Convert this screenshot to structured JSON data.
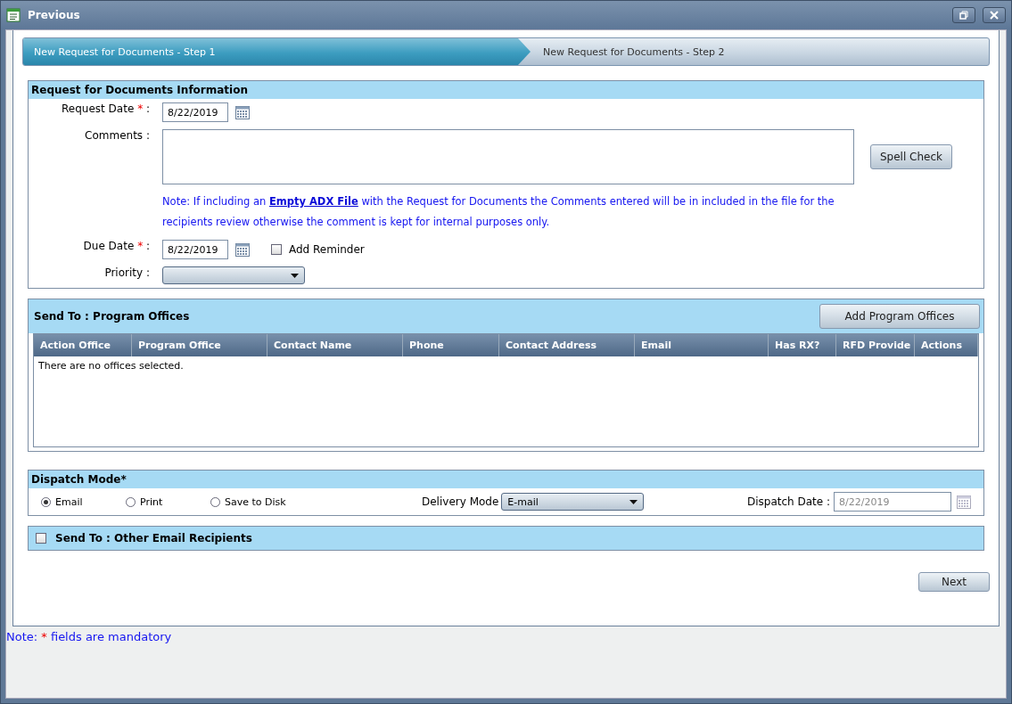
{
  "window": {
    "title": "Previous"
  },
  "steps": [
    {
      "label": "New Request for Documents - Step 1",
      "selected": true
    },
    {
      "label": "New Request for Documents - Step 2",
      "selected": false
    }
  ],
  "info": {
    "title": "Request for Documents Information",
    "required_marker": "*",
    "request_date": {
      "label": "Request Date",
      "required": true,
      "separator": ":",
      "value": "8/22/2019"
    },
    "comments": {
      "label": "Comments",
      "required": false,
      "separator": ":"
    },
    "note": {
      "before": "Note: If including an",
      "link": "Empty ADX File",
      "after": "with the Request for Documents the Comments entered will be in included in the file for the recipients review otherwise the comment is kept for internal purposes only."
    },
    "spell_check": "Spell Check",
    "due_date": {
      "label": "Due Date",
      "required": true,
      "separator": ":",
      "value": "8/22/2019"
    },
    "add_reminder": {
      "label": "Add Reminder",
      "checked": false
    },
    "priority": {
      "label": "Priority",
      "required": false,
      "separator": ":"
    }
  },
  "program_offices": {
    "title": "Send To : Program Offices",
    "button": "Add Program Offices",
    "columns": [
      "Action Office",
      "Program Office",
      "Contact Name",
      "Phone",
      "Contact Address",
      "Email",
      "Has RX?",
      "RFD Provide",
      "Actions"
    ],
    "empty_text": "There are no offices selected."
  },
  "dispatch": {
    "title": "Dispatch Mode*",
    "options": [
      {
        "label": "Email",
        "selected": true
      },
      {
        "label": "Print",
        "selected": false
      },
      {
        "label": "Save to Disk",
        "selected": false
      }
    ],
    "delivery_label": "Delivery Mode",
    "delivery_value": "E-mail",
    "date_label": "Dispatch Date :",
    "date_value": "8/22/2019"
  },
  "other_recipients": {
    "title": "Send To : Other Email Recipients",
    "checked": false
  },
  "next_button": "Next",
  "footer_note": {
    "prefix": "Note:",
    "marker": "*",
    "suffix": "fields are mandatory"
  }
}
